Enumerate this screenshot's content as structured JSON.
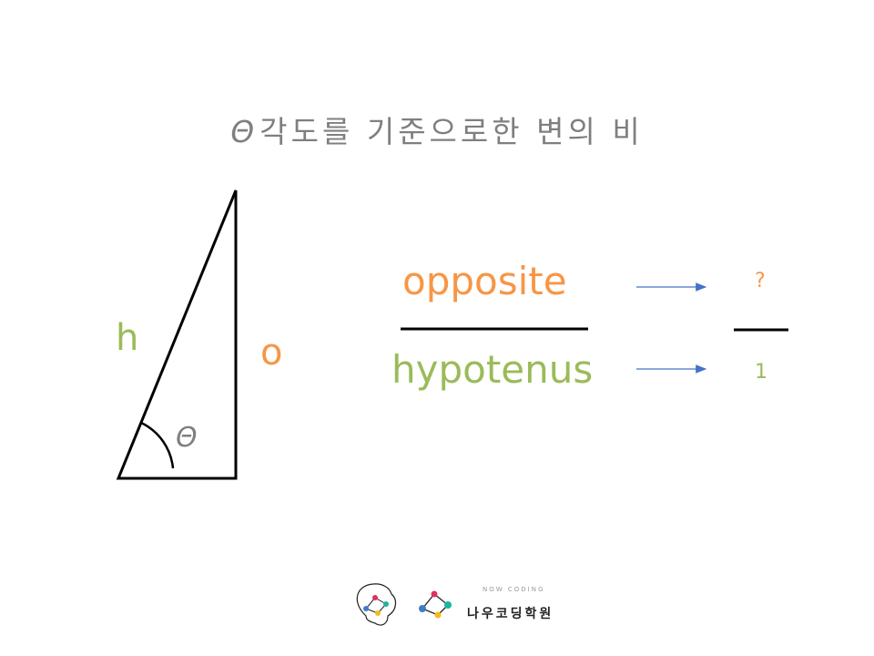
{
  "title": {
    "symbol": "Θ",
    "text": "각도를 기준으로한 변의 비"
  },
  "triangle": {
    "hypotenuse_label": "h",
    "opposite_label": "o",
    "angle_label": "Θ"
  },
  "fraction": {
    "numerator": "opposite",
    "denominator": "hypotenus"
  },
  "result": {
    "numerator": "?",
    "denominator": "1"
  },
  "logo": {
    "tagline": "NOW CODING",
    "name": "나우코딩학원"
  },
  "colors": {
    "orange": "#F79646",
    "green": "#9BBB59",
    "title": "#7f7f7f",
    "arrow": "#4472C4"
  }
}
